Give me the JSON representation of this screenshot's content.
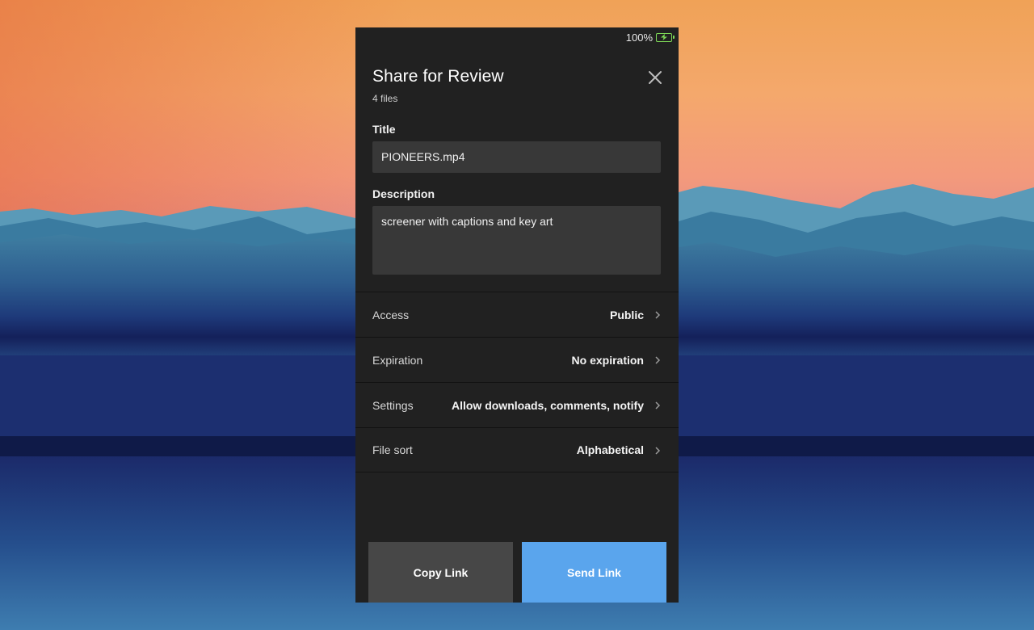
{
  "status_bar": {
    "battery_text": "100%",
    "battery_icon": "battery-charging-icon"
  },
  "dialog": {
    "title": "Share for Review",
    "subtitle": "4 files",
    "close_icon": "close-icon"
  },
  "form": {
    "title_label": "Title",
    "title_value": "PIONEERS.mp4",
    "description_label": "Description",
    "description_value": "screener with captions and key art"
  },
  "options": [
    {
      "label": "Access",
      "value": "Public"
    },
    {
      "label": "Expiration",
      "value": "No expiration"
    },
    {
      "label": "Settings",
      "value": "Allow downloads, comments, notify"
    },
    {
      "label": "File sort",
      "value": "Alphabetical"
    }
  ],
  "actions": {
    "copy_label": "Copy Link",
    "send_label": "Send Link"
  },
  "colors": {
    "panel_bg": "#212121",
    "field_bg": "#383838",
    "copy_button": "#474747",
    "send_button": "#5aa5ed",
    "battery": "#7ed957"
  }
}
